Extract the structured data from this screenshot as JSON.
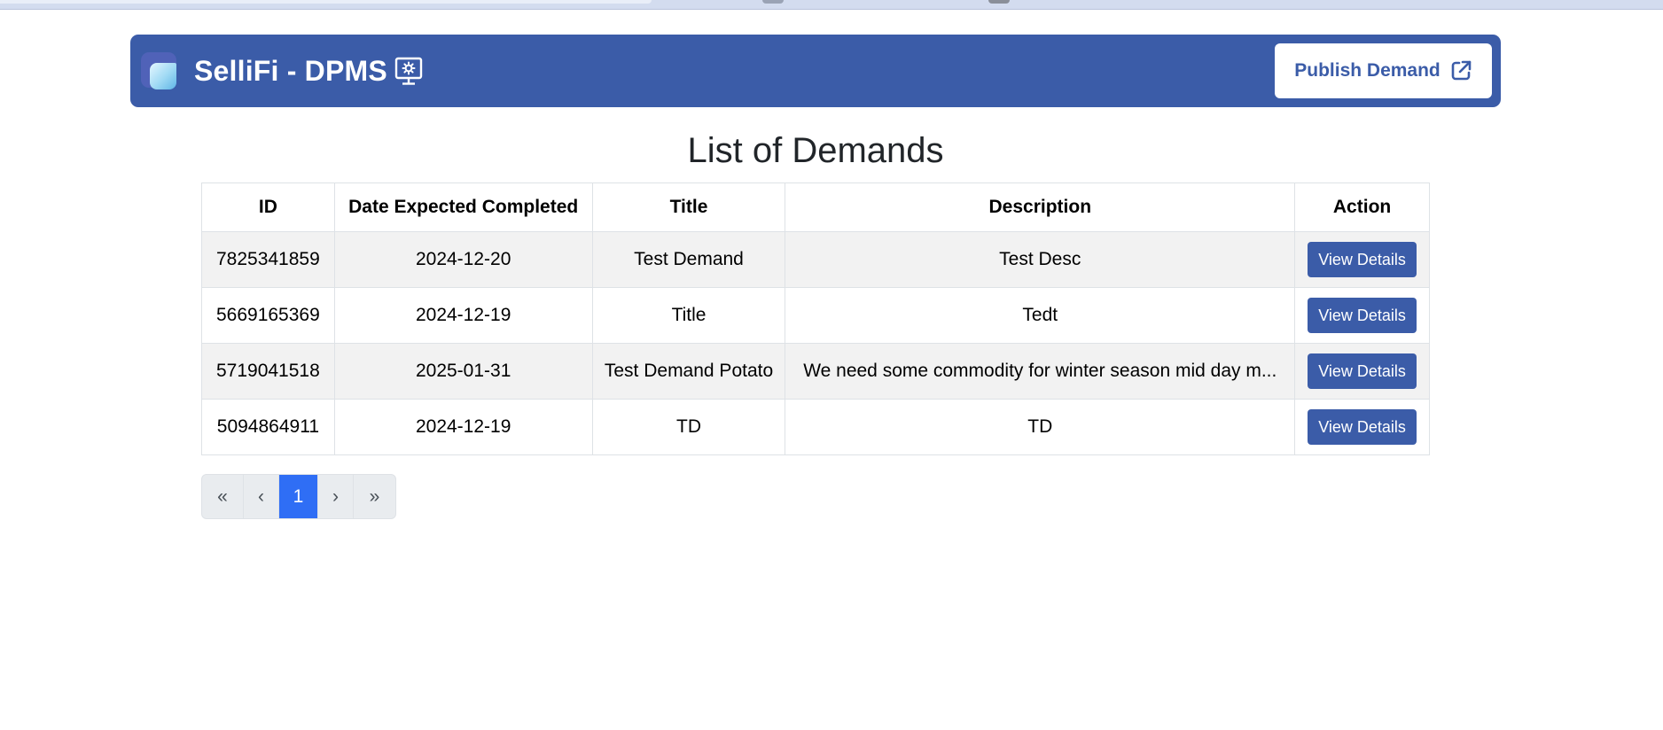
{
  "navbar": {
    "brand_title": "SelliFi - DPMS",
    "brand_icon": "monitor-gear-icon",
    "publish_label": "Publish Demand",
    "publish_icon": "external-link-icon",
    "accent_color": "#3b5ca8"
  },
  "page": {
    "heading": "List of Demands"
  },
  "table": {
    "headers": [
      "ID",
      "Date Expected Completed",
      "Title",
      "Description",
      "Action"
    ],
    "rows": [
      {
        "id": "7825341859",
        "date": "2024-12-20",
        "title": "Test Demand",
        "description": "Test Desc",
        "action": "View Details"
      },
      {
        "id": "5669165369",
        "date": "2024-12-19",
        "title": "Title",
        "description": "Tedt",
        "action": "View Details"
      },
      {
        "id": "5719041518",
        "date": "2025-01-31",
        "title": "Test Demand Potato",
        "description": "We need some commodity for winter season mid day m...",
        "action": "View Details"
      },
      {
        "id": "5094864911",
        "date": "2024-12-19",
        "title": "TD",
        "description": "TD",
        "action": "View Details"
      }
    ]
  },
  "pagination": {
    "first": "«",
    "prev": "‹",
    "current": "1",
    "next": "›",
    "last": "»",
    "active_color": "#2f6ef5"
  }
}
